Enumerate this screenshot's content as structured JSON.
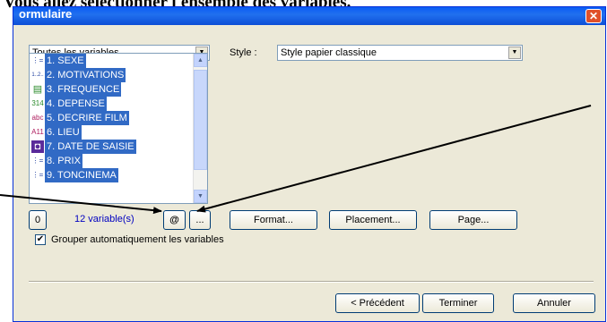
{
  "page": {
    "heading": "Vous allez sélectionner l'ensemble des variables."
  },
  "window": {
    "title": "ormulaire",
    "close_glyph": "✕"
  },
  "filter": {
    "value": "Toutes les variables"
  },
  "style": {
    "label": "Style :",
    "value": "Style papier classique"
  },
  "variables": [
    {
      "label": "1. SEXE",
      "icon": "single-choice-icon"
    },
    {
      "label": "2. MOTIVATIONS",
      "icon": "multiple-choice-icon"
    },
    {
      "label": "3. FREQUENCE",
      "icon": "scale-icon"
    },
    {
      "label": "4. DEPENSE",
      "icon": "numeric-icon"
    },
    {
      "label": "5. DECRIRE FILM",
      "icon": "text-icon"
    },
    {
      "label": "6. LIEU",
      "icon": "code-icon"
    },
    {
      "label": "7. DATE DE SAISIE",
      "icon": "date-icon"
    },
    {
      "label": "8. PRIX",
      "icon": "single-choice-icon"
    },
    {
      "label": "9. TONCINEMA",
      "icon": "single-choice-icon"
    }
  ],
  "icons": {
    "single": "⋮=",
    "multiple": "1..2..",
    "scale": "▤",
    "numeric": "314",
    "text": "abc",
    "code": "A11",
    "date": "◘"
  },
  "toolbar": {
    "zero_label": "0",
    "count_text": "12 variable(s)",
    "at_label": "@",
    "ellipsis_label": "...",
    "format_label": "Format...",
    "placement_label": "Placement...",
    "page_label": "Page..."
  },
  "options": {
    "group_label": "Grouper automatiquement les variables",
    "group_checked_glyph": "✔"
  },
  "footer": {
    "prev_label": "< Précédent",
    "finish_label": "Terminer",
    "cancel_label": "Annuler"
  },
  "colors": {
    "selection": "#316ac5",
    "titlebar": "#0a5cf4",
    "count_text": "#0000c0"
  }
}
